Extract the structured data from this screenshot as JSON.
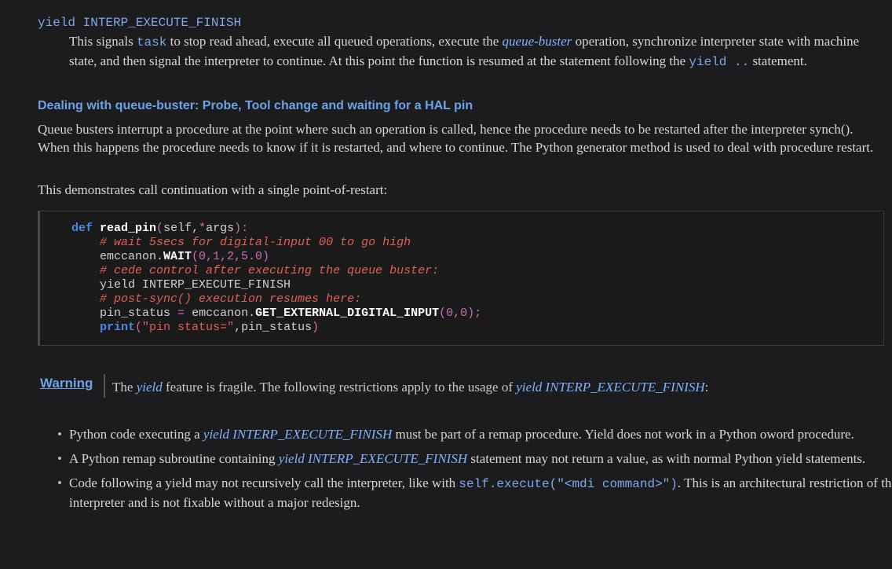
{
  "definition": {
    "term": "yield INTERP_EXECUTE_FINISH",
    "desc_1": "This signals ",
    "desc_code_task": "task",
    "desc_2": " to stop read ahead, execute all queued operations, execute the ",
    "desc_link_queue_buster": "queue-buster",
    "desc_3": " operation, synchronize interpreter state with machine state, and then signal the interpreter to continue. At this point the function is resumed at the statement following the ",
    "desc_code_yield": "yield ..",
    "desc_4": " statement."
  },
  "section": {
    "title": "Dealing with queue-buster: Probe, Tool change and waiting for a HAL pin",
    "para1": "Queue busters interrupt a procedure at the point where such an operation is called, hence the procedure needs to be restarted after the interpreter synch(). When this happens the procedure needs to know if it is restarted, and where to continue. The Python generator method is used to deal with procedure restart.",
    "para2": "This demonstrates call continuation with a single point-of-restart:"
  },
  "code": {
    "l1_kw": "def",
    "l1_fn": "read_pin",
    "l1_rest_a": "(",
    "l1_self": "self,",
    "l1_star": "*",
    "l1_args": "args",
    "l1_close": "):",
    "l2": "# wait 5secs for digital-input 00 to go high",
    "l3_obj": "emccanon.",
    "l3_call": "WAIT",
    "l3_args": "(0,1,2,5.0)",
    "l4": "# cede control after executing the queue buster:",
    "l5": "yield INTERP_EXECUTE_FINISH",
    "l6": "# post-sync() execution resumes here:",
    "l7_var": "pin_status ",
    "l7_eq": "=",
    "l7_obj": " emccanon.",
    "l7_call": "GET_EXTERNAL_DIGITAL_INPUT",
    "l7_args": "(0,0);",
    "l8_kw": "print",
    "l8_open": "(",
    "l8_str": "\"pin status=\"",
    "l8_rest": ",pin_status",
    "l8_close": ")"
  },
  "warning": {
    "label": "Warning",
    "text_1": "The ",
    "link_yield": "yield",
    "text_2": " feature is fragile. The following restrictions apply to the usage of ",
    "link_yield_finish": "yield INTERP_EXECUTE_FINISH",
    "text_3": ":"
  },
  "bullets": [
    {
      "a": "Python code executing a ",
      "link": "yield INTERP_EXECUTE_FINISH",
      "b": " must be part of a remap procedure. Yield does not work in a Python oword procedure."
    },
    {
      "a": "A Python remap subroutine containing ",
      "link": "yield INTERP_EXECUTE_FINISH",
      "b": " statement may not return a value, as with normal Python yield statements."
    },
    {
      "a": "Code following a yield may not recursively call the interpreter, like with ",
      "code": "self.execute(\"<mdi command>\")",
      "b": ". This is an architectural restriction of the interpreter and is not fixable without a major redesign."
    }
  ]
}
